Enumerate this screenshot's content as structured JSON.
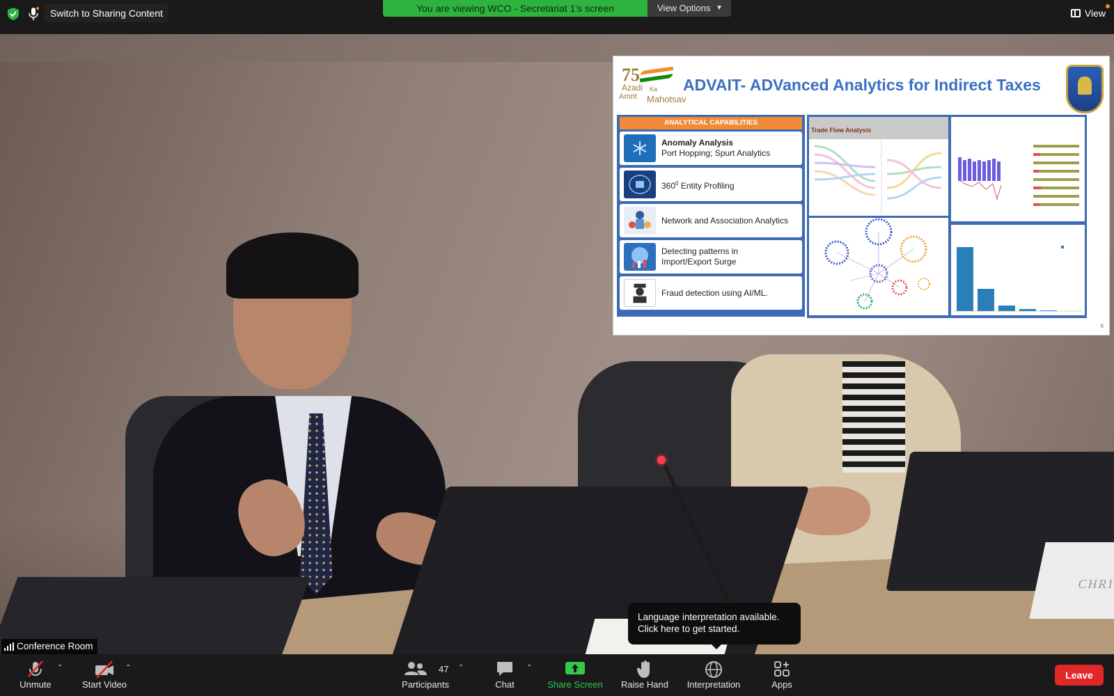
{
  "topbar": {
    "switch_label": "Switch to Sharing Content",
    "viewing_banner": "You are viewing WCO - Secretariat 1's screen",
    "view_options": "View Options",
    "view_label": "View"
  },
  "slide": {
    "logo_75": "75",
    "logo_azadi": "Azadi",
    "logo_ka": "Ka",
    "logo_amrit": "Amrit",
    "logo_mahotsav": "Mahotsav",
    "title": "ADVAIT- ADVanced Analytics for Indirect Taxes",
    "capabilities_header": "ANALYTICAL CAPABILITIES",
    "capabilities": [
      {
        "title": "Anomaly Analysis",
        "subtitle": "Port Hopping; Spurt Analytics",
        "icon": "snowflake-icon"
      },
      {
        "title": "360",
        "sup": "0",
        "rest": " Entity Profiling",
        "icon": "brain-ai-icon"
      },
      {
        "title": "Network and Association Analytics",
        "icon": "people-network-icon"
      },
      {
        "line1": "Detecting patterns in",
        "line2": "Import/Export Surge",
        "icon": "chart-globe-icon"
      },
      {
        "title": "Fraud detection using AI/ML.",
        "icon": "fraud-spy-icon"
      }
    ],
    "trade_flow_title": "Trade Flow Analysis",
    "page_number": "6"
  },
  "tooltip": {
    "line1": "Language interpretation available.",
    "line2": "Click here to get started."
  },
  "room_label": "Conference Room",
  "toolbar": {
    "unmute": "Unmute",
    "start_video": "Start Video",
    "participants": "Participants",
    "participant_count": "47",
    "chat": "Chat",
    "share_screen": "Share Screen",
    "raise_hand": "Raise Hand",
    "interpretation": "Interpretation",
    "apps": "Apps",
    "leave": "Leave"
  },
  "colors": {
    "banner_green": "#2fb33f",
    "share_green": "#35c94b",
    "leave_red": "#e02828",
    "slide_title_blue": "#3a6fc4",
    "cap_header_orange": "#f08a36"
  }
}
